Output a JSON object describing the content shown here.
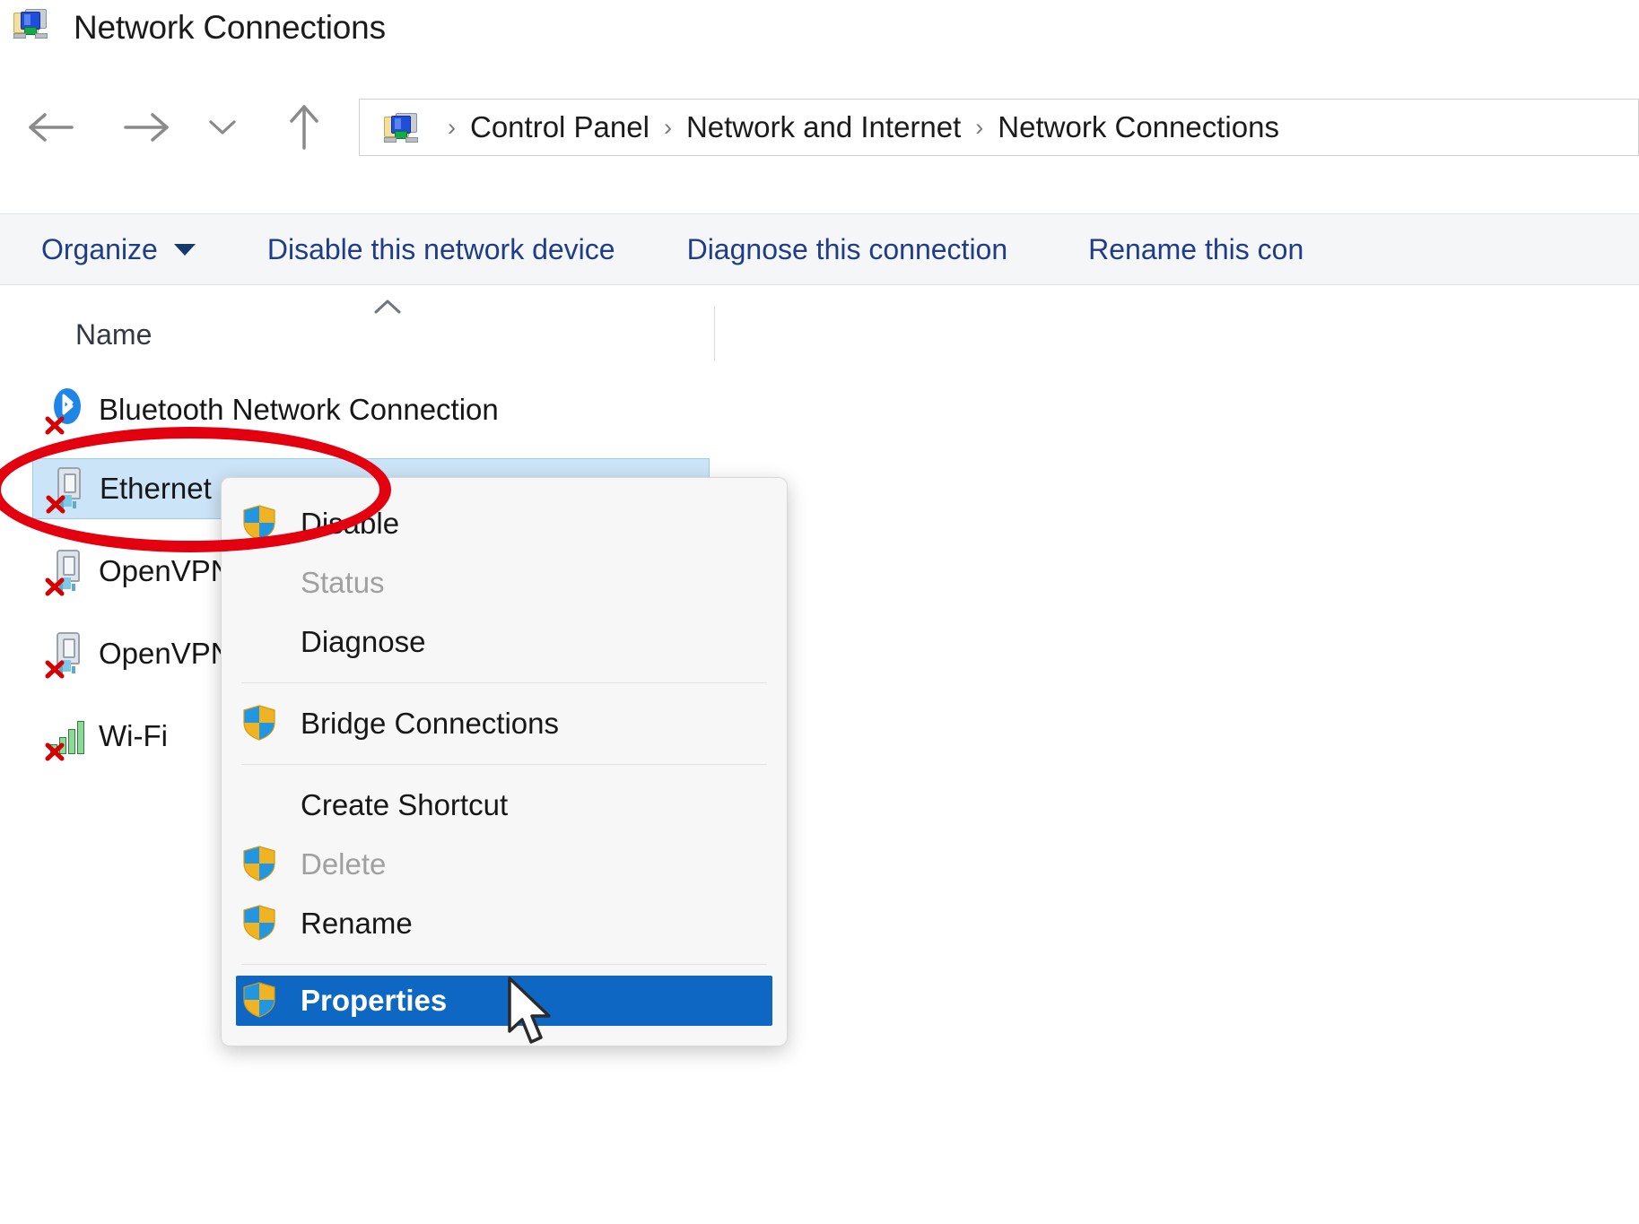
{
  "window": {
    "title": "Network Connections",
    "icon": "network-connections-icon"
  },
  "nav": {
    "back_icon": "back-arrow-icon",
    "forward_icon": "forward-arrow-icon",
    "recent_icon": "chevron-down-icon",
    "up_icon": "up-arrow-icon"
  },
  "address_bar": {
    "icon": "network-connections-icon",
    "separator": "›",
    "crumbs": [
      "Control Panel",
      "Network and Internet",
      "Network Connections"
    ]
  },
  "command_bar": {
    "organize": "Organize",
    "organize_caret": "▼",
    "disable_device": "Disable this network device",
    "diagnose_connection": "Diagnose this connection",
    "rename_connection": "Rename this con"
  },
  "columns": {
    "name": "Name",
    "sort_indicator": "ascending"
  },
  "connections": [
    {
      "name": "Bluetooth Network Connection",
      "icon": "bluetooth-icon",
      "disabled_badge": true,
      "selected": false
    },
    {
      "name": "Ethernet",
      "icon": "network-adapter-icon",
      "disabled_badge": true,
      "selected": true
    },
    {
      "name": "OpenVPN",
      "icon": "network-adapter-icon",
      "disabled_badge": true,
      "selected": false
    },
    {
      "name": "OpenVPN",
      "icon": "network-adapter-icon",
      "disabled_badge": true,
      "selected": false
    },
    {
      "name": "Wi-Fi",
      "icon": "wifi-signal-icon",
      "disabled_badge": true,
      "selected": false
    }
  ],
  "context_menu": {
    "items": [
      {
        "label": "Disable",
        "shield": true,
        "disabled": false,
        "highlighted": false
      },
      {
        "label": "Status",
        "shield": false,
        "disabled": true,
        "highlighted": false
      },
      {
        "label": "Diagnose",
        "shield": false,
        "disabled": false,
        "highlighted": false
      },
      {
        "label": "Bridge Connections",
        "shield": true,
        "disabled": false,
        "highlighted": false
      },
      {
        "label": "Create Shortcut",
        "shield": false,
        "disabled": false,
        "highlighted": false
      },
      {
        "label": "Delete",
        "shield": true,
        "disabled": true,
        "highlighted": false
      },
      {
        "label": "Rename",
        "shield": true,
        "disabled": false,
        "highlighted": false
      },
      {
        "label": "Properties",
        "shield": true,
        "disabled": false,
        "highlighted": true
      }
    ]
  },
  "annotation": {
    "shape": "ellipse",
    "color": "#e3000f",
    "target": "Ethernet"
  },
  "colors": {
    "selection_blue": "#cce4f7",
    "menu_highlight_blue": "#0f67c4",
    "command_link_blue": "#1f3c88",
    "annotation_red": "#e3000f"
  }
}
